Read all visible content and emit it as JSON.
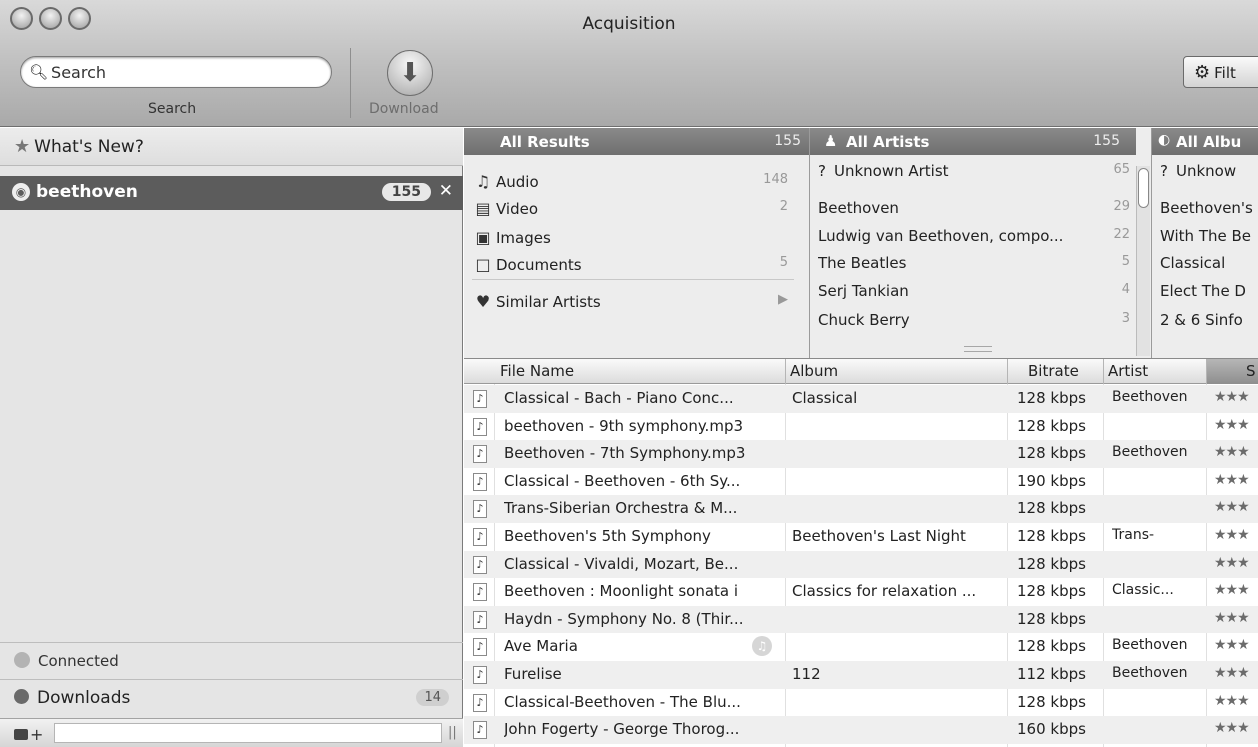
{
  "window": {
    "title": "Acquisition"
  },
  "toolbar": {
    "search_placeholder": "Search",
    "search_label": "Search",
    "download_label": "Download",
    "filter_label": "Filt"
  },
  "sidebar": {
    "whats_new": "What's New?",
    "search_item": {
      "label": "beethoven",
      "count": "155"
    },
    "connected": "Connected",
    "downloads": {
      "label": "Downloads",
      "count": "14"
    }
  },
  "results_pane": {
    "header": {
      "label": "All Results",
      "count": "155"
    },
    "items": [
      {
        "icon": "audio-icon",
        "label": "Audio",
        "count": "148"
      },
      {
        "icon": "video-icon",
        "label": "Video",
        "count": "2"
      },
      {
        "icon": "images-icon",
        "label": "Images",
        "count": ""
      },
      {
        "icon": "documents-icon",
        "label": "Documents",
        "count": "5"
      }
    ],
    "similar": "Similar Artists"
  },
  "artists_pane": {
    "header": {
      "label": "All Artists",
      "count": "155"
    },
    "items": [
      {
        "label": "Unknown Artist",
        "count": "65"
      },
      {
        "label": "Beethoven",
        "count": "29"
      },
      {
        "label": "Ludwig van Beethoven, compo...",
        "count": "22"
      },
      {
        "label": "The Beatles",
        "count": "5"
      },
      {
        "label": "Serj Tankian",
        "count": "4"
      },
      {
        "label": "Chuck Berry",
        "count": "3"
      }
    ]
  },
  "albums_pane": {
    "header": {
      "label": "All Albu"
    },
    "items": [
      {
        "label": "Unknow"
      },
      {
        "label": "Beethoven's"
      },
      {
        "label": "With The Be"
      },
      {
        "label": "Classical"
      },
      {
        "label": "Elect The D"
      },
      {
        "label": "2 & 6 Sinfo"
      }
    ]
  },
  "table": {
    "columns": [
      "File Name",
      "Album",
      "Bitrate",
      "Artist",
      "S"
    ],
    "rows": [
      {
        "file": "Classical - Bach - Piano Conc...",
        "album": "Classical",
        "bitrate": "128 kbps",
        "artist": "Beethoven",
        "stars": "★★★"
      },
      {
        "file": "beethoven - 9th symphony.mp3",
        "album": "",
        "bitrate": "128 kbps",
        "artist": "",
        "stars": "★★★"
      },
      {
        "file": "Beethoven - 7th Symphony.mp3",
        "album": "",
        "bitrate": "128 kbps",
        "artist": "Beethoven",
        "stars": "★★★"
      },
      {
        "file": "Classical - Beethoven - 6th Sy...",
        "album": "",
        "bitrate": "190 kbps",
        "artist": "",
        "stars": "★★★"
      },
      {
        "file": "Trans-Siberian Orchestra & M...",
        "album": "",
        "bitrate": "128 kbps",
        "artist": "",
        "stars": "★★★"
      },
      {
        "file": "Beethoven's 5th Symphony",
        "album": "Beethoven's Last Night",
        "bitrate": "128 kbps",
        "artist": "Trans-",
        "stars": "★★★"
      },
      {
        "file": "Classical - Vivaldi, Mozart, Be...",
        "album": "",
        "bitrate": "128 kbps",
        "artist": "",
        "stars": "★★★"
      },
      {
        "file": "Beethoven : Moonlight sonata i",
        "album": "Classics for relaxation ...",
        "bitrate": "128 kbps",
        "artist": "Classic...",
        "stars": "★★★"
      },
      {
        "file": "Haydn - Symphony No. 8 (Thir...",
        "album": "",
        "bitrate": "128 kbps",
        "artist": "",
        "stars": "★★★"
      },
      {
        "file": "Ave Maria",
        "album": "",
        "bitrate": "128 kbps",
        "artist": "Beethoven",
        "stars": "★★★"
      },
      {
        "file": "Furelise",
        "album": "112",
        "bitrate": "112 kbps",
        "artist": "Beethoven",
        "stars": "★★★"
      },
      {
        "file": "Classical-Beethoven - The Blu...",
        "album": "",
        "bitrate": "128 kbps",
        "artist": "",
        "stars": "★★★"
      },
      {
        "file": "John Fogerty - George Thorog...",
        "album": "",
        "bitrate": "160 kbps",
        "artist": "",
        "stars": "★★★"
      }
    ]
  }
}
